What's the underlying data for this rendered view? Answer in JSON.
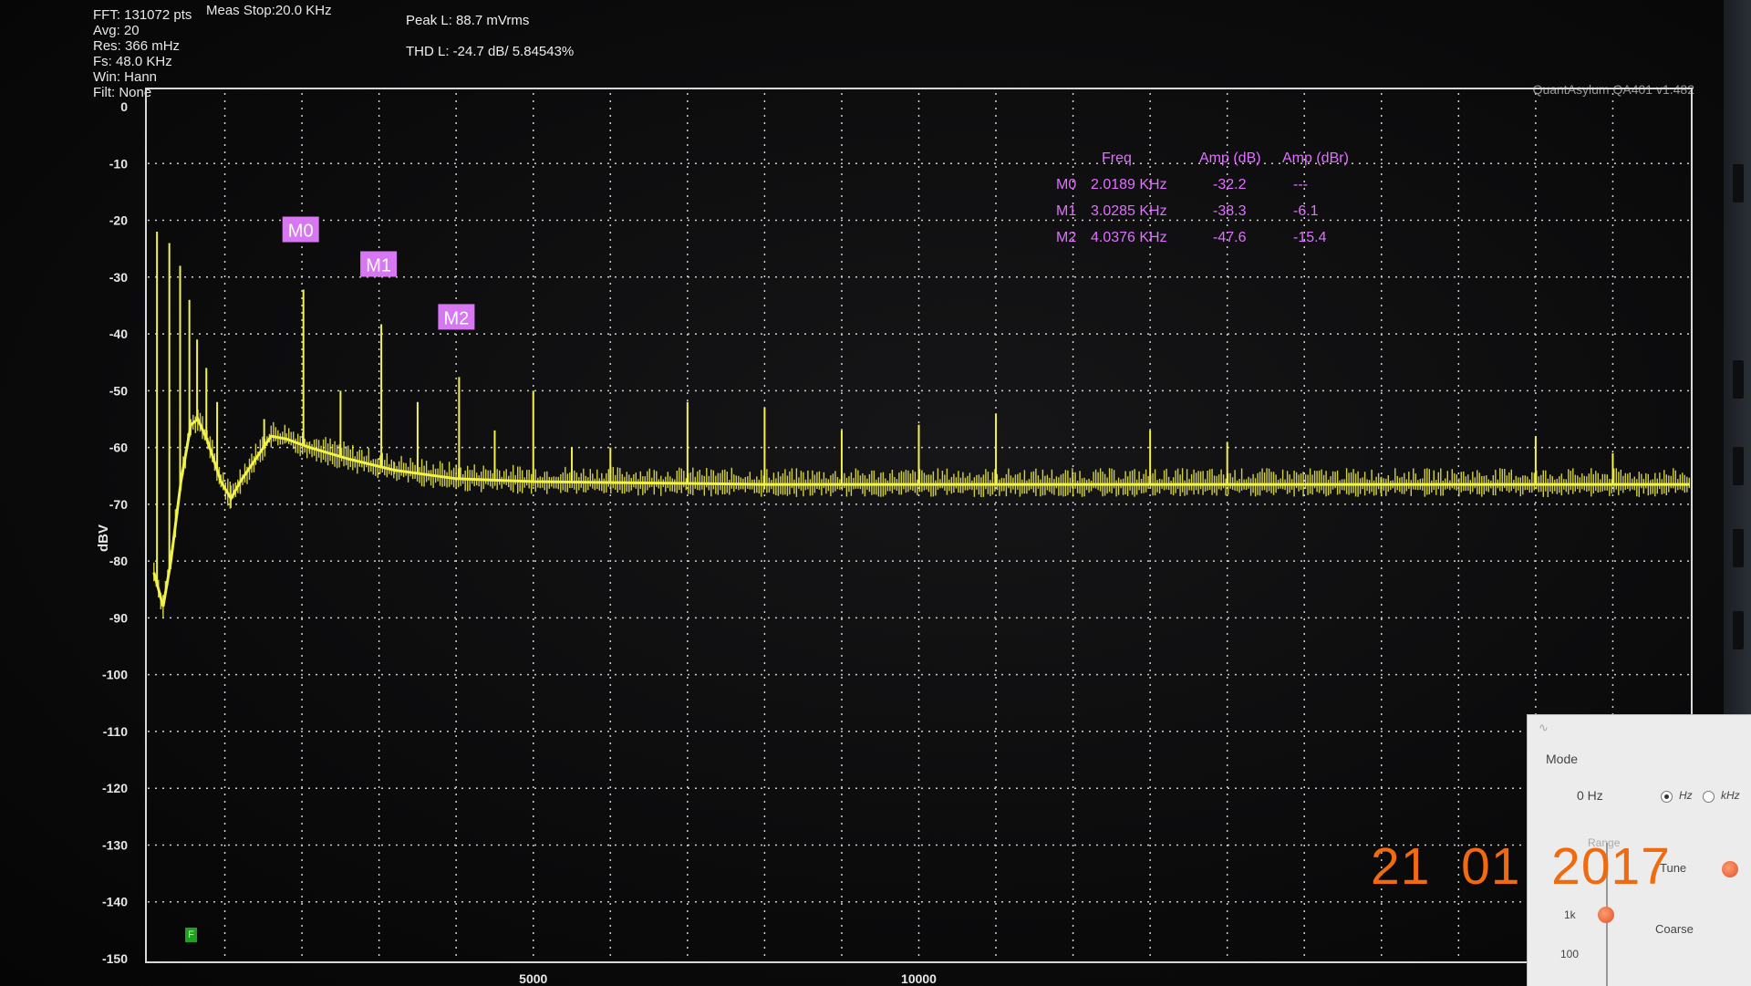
{
  "header": {
    "info_left": [
      "FFT: 131072 pts",
      "Avg: 20",
      "Res: 366 mHz",
      "Fs: 48.0 KHz",
      "Win: Hann",
      "Filt: None"
    ],
    "meas_stop": "Meas Stop:20.0 KHz",
    "peak": "Peak L: 88.7 mVrms",
    "thd": "THD L: -24.7 dB/ 5.84543%",
    "version": "QuantAsylum QA401 v1.482"
  },
  "chart_data": {
    "type": "line",
    "ylabel": "dBV",
    "xlabel": "",
    "xlim": [
      0,
      20000
    ],
    "ylim": [
      -150,
      0
    ],
    "y_ticks": [
      "0",
      "-10",
      "-20",
      "-30",
      "-40",
      "-50",
      "-60",
      "-70",
      "-80",
      "-90",
      "-100",
      "-110",
      "-120",
      "-130",
      "-140",
      "-150"
    ],
    "x_ticks": [
      {
        "value": 5000,
        "label": "5000"
      },
      {
        "value": 10000,
        "label": "10000"
      }
    ],
    "grid": true,
    "series": [
      {
        "color": "#f2f24a",
        "noise_floor": [
          [
            80,
            -82
          ],
          [
            200,
            -88
          ],
          [
            300,
            -80
          ],
          [
            430,
            -66
          ],
          [
            560,
            -56
          ],
          [
            650,
            -55
          ],
          [
            780,
            -59
          ],
          [
            950,
            -66
          ],
          [
            1080,
            -69
          ],
          [
            1200,
            -66
          ],
          [
            1400,
            -62
          ],
          [
            1600,
            -58
          ],
          [
            1800,
            -58.5
          ],
          [
            2100,
            -60
          ],
          [
            2600,
            -62
          ],
          [
            3200,
            -64
          ],
          [
            4000,
            -65.5
          ],
          [
            5000,
            -66
          ],
          [
            8000,
            -66.5
          ],
          [
            12000,
            -66.5
          ],
          [
            16000,
            -66.5
          ],
          [
            20000,
            -66.5
          ]
        ],
        "harmonics": [
          {
            "x": 120,
            "y": -22
          },
          {
            "x": 280,
            "y": -24
          },
          {
            "x": 420,
            "y": -28
          },
          {
            "x": 540,
            "y": -34
          },
          {
            "x": 640,
            "y": -41
          },
          {
            "x": 760,
            "y": -46
          },
          {
            "x": 900,
            "y": -52
          },
          {
            "x": 1510,
            "y": -55
          },
          {
            "x": 2019,
            "y": -32.2
          },
          {
            "x": 2500,
            "y": -50
          },
          {
            "x": 3029,
            "y": -38.3
          },
          {
            "x": 3500,
            "y": -52
          },
          {
            "x": 4038,
            "y": -47.6
          },
          {
            "x": 4500,
            "y": -57
          },
          {
            "x": 5000,
            "y": -50
          },
          {
            "x": 5500,
            "y": -60
          },
          {
            "x": 6000,
            "y": -60
          },
          {
            "x": 7000,
            "y": -52
          },
          {
            "x": 8000,
            "y": -53
          },
          {
            "x": 9000,
            "y": -57
          },
          {
            "x": 10000,
            "y": -56
          },
          {
            "x": 11000,
            "y": -54
          },
          {
            "x": 13000,
            "y": -57
          },
          {
            "x": 14000,
            "y": -59
          },
          {
            "x": 18000,
            "y": -58
          },
          {
            "x": 19000,
            "y": -61
          }
        ]
      }
    ],
    "markers": [
      {
        "label": "M0",
        "x": 2019,
        "y": -32.2
      },
      {
        "label": "M1",
        "x": 3029,
        "y": -38.3
      },
      {
        "label": "M2",
        "x": 4038,
        "y": -47.6
      }
    ],
    "marker_table": {
      "headers": [
        "Freq",
        "Amp (dB)",
        "Amp (dBr)"
      ],
      "rows": [
        {
          "name": "M0",
          "freq": "2.0189 KHz",
          "amp_db": "-32.2",
          "amp_dbr": "---"
        },
        {
          "name": "M1",
          "freq": "3.0285 KHz",
          "amp_db": "-38.3",
          "amp_dbr": "-6.1"
        },
        {
          "name": "M2",
          "freq": "4.0376 KHz",
          "amp_db": "-47.6",
          "amp_dbr": "-15.4"
        }
      ]
    }
  },
  "status_indicator": "F",
  "generator_panel": {
    "mode_label": "Mode",
    "freq_value": "0 Hz",
    "unit_hz": "Hz",
    "unit_khz": "kHz",
    "range_label": "Range",
    "tune_label": "Tune",
    "coarse_label": "Coarse",
    "scale_1k": "1k",
    "scale_100": "100"
  },
  "datestamp": "21  01  2017",
  "colors": {
    "trace": "#f2f24a",
    "marker": "#d777f2",
    "marker_text": "#e070ff",
    "datestamp": "#f06a10"
  }
}
